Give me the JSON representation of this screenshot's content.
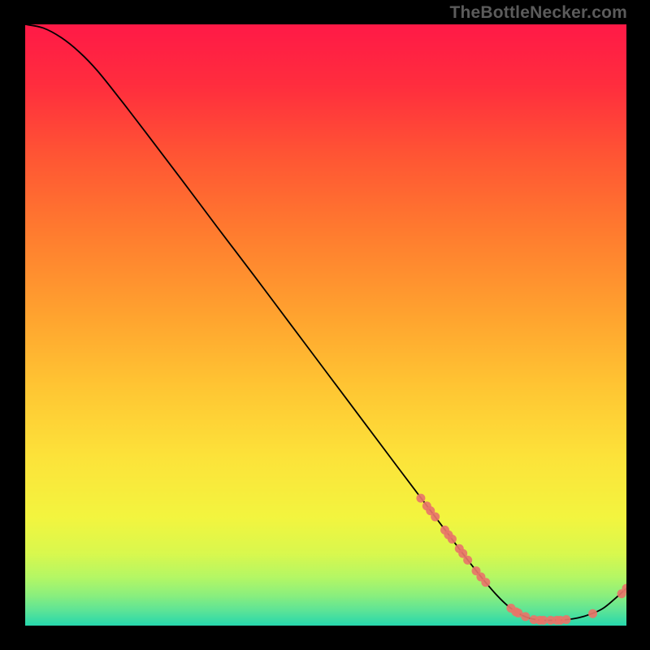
{
  "watermark": "TheBottleNecker.com",
  "chart_data": {
    "type": "line",
    "title": "",
    "xlabel": "",
    "ylabel": "",
    "xlim": [
      0,
      100
    ],
    "ylim": [
      0,
      100
    ],
    "grid": false,
    "legend": false,
    "series": [
      {
        "name": "curve",
        "color": "#000000",
        "points": [
          {
            "x": 0,
            "y": 100.0
          },
          {
            "x": 3,
            "y": 99.4
          },
          {
            "x": 6,
            "y": 97.8
          },
          {
            "x": 9,
            "y": 95.4
          },
          {
            "x": 12,
            "y": 92.3
          },
          {
            "x": 16,
            "y": 87.3
          },
          {
            "x": 20,
            "y": 82.1
          },
          {
            "x": 26,
            "y": 74.2
          },
          {
            "x": 32,
            "y": 66.2
          },
          {
            "x": 38,
            "y": 58.3
          },
          {
            "x": 44,
            "y": 50.3
          },
          {
            "x": 50,
            "y": 42.3
          },
          {
            "x": 56,
            "y": 34.3
          },
          {
            "x": 62,
            "y": 26.3
          },
          {
            "x": 66,
            "y": 21.0
          },
          {
            "x": 70,
            "y": 15.7
          },
          {
            "x": 73,
            "y": 11.7
          },
          {
            "x": 76,
            "y": 7.9
          },
          {
            "x": 78.5,
            "y": 5.0
          },
          {
            "x": 80.5,
            "y": 3.1
          },
          {
            "x": 82.5,
            "y": 1.8
          },
          {
            "x": 84,
            "y": 1.2
          },
          {
            "x": 86,
            "y": 0.9
          },
          {
            "x": 88,
            "y": 0.9
          },
          {
            "x": 90,
            "y": 1.0
          },
          {
            "x": 92,
            "y": 1.3
          },
          {
            "x": 94,
            "y": 1.9
          },
          {
            "x": 96,
            "y": 2.8
          },
          {
            "x": 98,
            "y": 4.4
          },
          {
            "x": 100,
            "y": 6.2
          }
        ]
      }
    ],
    "markers": {
      "color": "#e87569",
      "radius_px": 5.5,
      "points": [
        {
          "x": 65.8,
          "y": 21.2
        },
        {
          "x": 66.8,
          "y": 19.9
        },
        {
          "x": 67.4,
          "y": 19.1
        },
        {
          "x": 68.2,
          "y": 18.1
        },
        {
          "x": 69.8,
          "y": 15.9
        },
        {
          "x": 70.4,
          "y": 15.1
        },
        {
          "x": 71.0,
          "y": 14.4
        },
        {
          "x": 72.2,
          "y": 12.8
        },
        {
          "x": 72.8,
          "y": 12.0
        },
        {
          "x": 73.6,
          "y": 10.9
        },
        {
          "x": 75.0,
          "y": 9.1
        },
        {
          "x": 75.8,
          "y": 8.1
        },
        {
          "x": 76.6,
          "y": 7.2
        },
        {
          "x": 80.8,
          "y": 2.9
        },
        {
          "x": 81.6,
          "y": 2.3
        },
        {
          "x": 82.0,
          "y": 2.1
        },
        {
          "x": 83.2,
          "y": 1.5
        },
        {
          "x": 84.6,
          "y": 1.0
        },
        {
          "x": 85.6,
          "y": 0.9
        },
        {
          "x": 86.2,
          "y": 0.9
        },
        {
          "x": 87.4,
          "y": 0.9
        },
        {
          "x": 88.4,
          "y": 0.9
        },
        {
          "x": 89.0,
          "y": 0.9
        },
        {
          "x": 90.0,
          "y": 1.0
        },
        {
          "x": 94.4,
          "y": 2.0
        },
        {
          "x": 99.2,
          "y": 5.3
        },
        {
          "x": 100.0,
          "y": 6.2
        }
      ]
    },
    "gradient_stops": [
      {
        "offset": 0.0,
        "color": "#ff1a47"
      },
      {
        "offset": 0.1,
        "color": "#ff2d3e"
      },
      {
        "offset": 0.22,
        "color": "#ff5634"
      },
      {
        "offset": 0.35,
        "color": "#ff7d2f"
      },
      {
        "offset": 0.48,
        "color": "#ffa22f"
      },
      {
        "offset": 0.6,
        "color": "#ffc533"
      },
      {
        "offset": 0.72,
        "color": "#fde33a"
      },
      {
        "offset": 0.82,
        "color": "#f3f53f"
      },
      {
        "offset": 0.88,
        "color": "#d9f84e"
      },
      {
        "offset": 0.92,
        "color": "#b4f765"
      },
      {
        "offset": 0.95,
        "color": "#8aef7e"
      },
      {
        "offset": 0.975,
        "color": "#5de497"
      },
      {
        "offset": 1.0,
        "color": "#26d8ad"
      }
    ]
  }
}
